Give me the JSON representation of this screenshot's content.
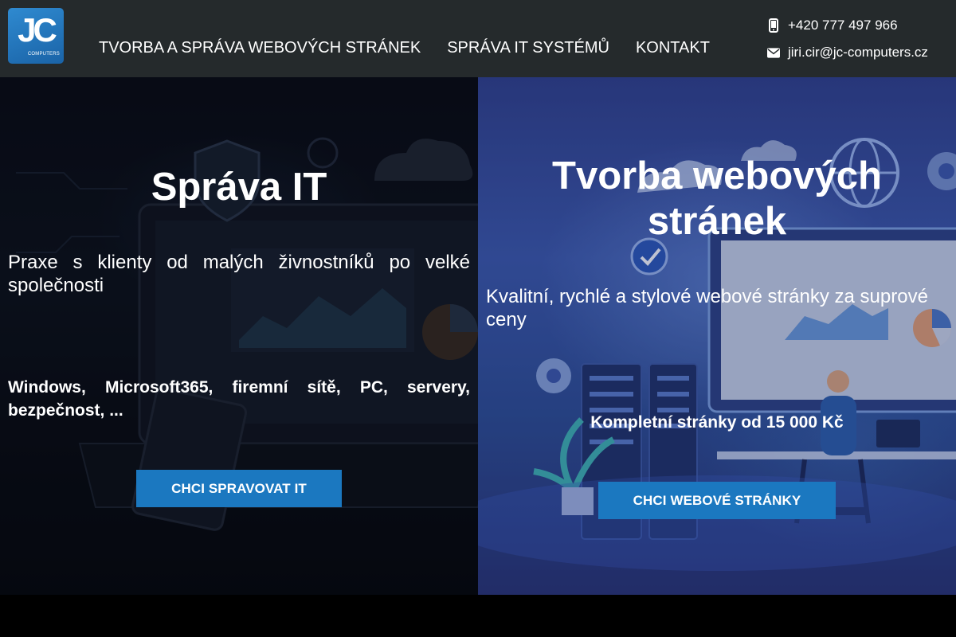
{
  "logo": {
    "mark": "JC",
    "text": "COMPUTERS"
  },
  "nav": {
    "items": [
      {
        "label": "TVORBA A SPRÁVA WEBOVÝCH STRÁNEK"
      },
      {
        "label": "SPRÁVA IT SYSTÉMŮ"
      },
      {
        "label": "KONTAKT"
      }
    ]
  },
  "contacts": {
    "phone": "+420 777 497 966",
    "phone_icon": "mobile-phone-icon",
    "email": "jiri.cir@jc-computers.cz",
    "email_icon": "envelope-icon"
  },
  "left_panel": {
    "title": "Správa IT",
    "lead": "Praxe s klienty od malých živnostníků po velké společnosti",
    "features": "Windows, Microsoft365, firemní sítě, PC, servery, bezpečnost, ...",
    "cta_label": "CHCI SPRAVOVAT IT"
  },
  "right_panel": {
    "title_line1": "Tvorba webových",
    "title_line2": "stránek",
    "lead": "Kvalitní, rychlé a stylové webové stránky za suprové ceny",
    "price": "Kompletní stránky od 15 000 Kč",
    "cta_label": "CHCI WEBOVÉ STRÁNKY"
  },
  "colors": {
    "header_bg": "#252a2c",
    "accent_button": "#1b78c0",
    "logo_blue": "#1f6fb5",
    "text": "#ffffff"
  }
}
